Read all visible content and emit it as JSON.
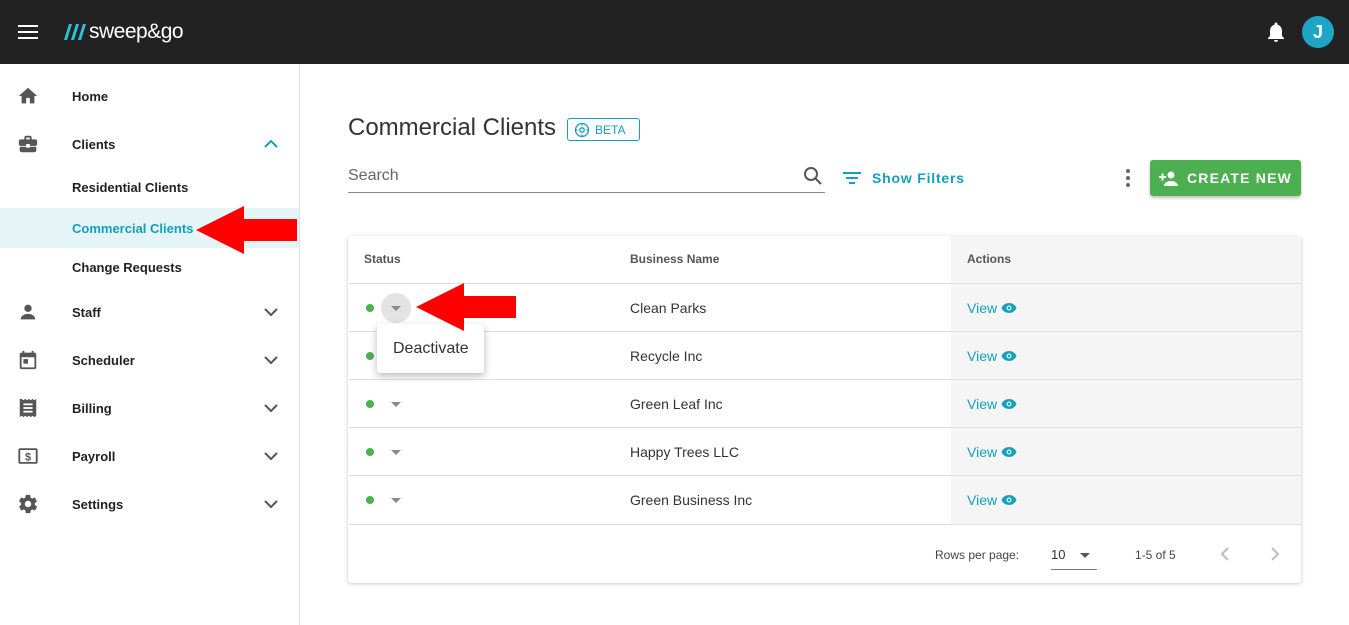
{
  "app": {
    "logo_text": "sweep&go",
    "avatar_initial": "J"
  },
  "sidebar": {
    "items": [
      {
        "label": "Home",
        "icon": "home-icon"
      },
      {
        "label": "Clients",
        "icon": "briefcase-icon",
        "expanded": true
      },
      {
        "label": "Residential Clients"
      },
      {
        "label": "Commercial Clients",
        "active": true
      },
      {
        "label": "Change Requests"
      },
      {
        "label": "Staff",
        "icon": "person-icon"
      },
      {
        "label": "Scheduler",
        "icon": "calendar-icon"
      },
      {
        "label": "Billing",
        "icon": "receipt-icon"
      },
      {
        "label": "Payroll",
        "icon": "dollar-icon"
      },
      {
        "label": "Settings",
        "icon": "gear-icon"
      }
    ]
  },
  "main": {
    "title": "Commercial Clients",
    "badge": "BETA",
    "search_placeholder": "Search",
    "filters_label": "Show Filters",
    "create_label": "CREATE NEW"
  },
  "table": {
    "headers": {
      "status": "Status",
      "business": "Business Name",
      "actions": "Actions"
    },
    "rows": [
      {
        "status": "active",
        "business": "Clean Parks",
        "action": "View"
      },
      {
        "status": "active",
        "business": "Recycle Inc",
        "action": "View"
      },
      {
        "status": "active",
        "business": "Green Leaf Inc",
        "action": "View"
      },
      {
        "status": "active",
        "business": "Happy Trees LLC",
        "action": "View"
      },
      {
        "status": "active",
        "business": "Green Business Inc",
        "action": "View"
      }
    ],
    "rows_per_page_label": "Rows per page:",
    "rows_per_page": "10",
    "range": "1-5 of 5"
  },
  "status_menu": {
    "item": "Deactivate"
  },
  "colors": {
    "accent": "#12a0bd",
    "topbar": "#222222",
    "create": "#4caf50",
    "status_active": "#4caf50",
    "annotation": "#ff0000"
  }
}
